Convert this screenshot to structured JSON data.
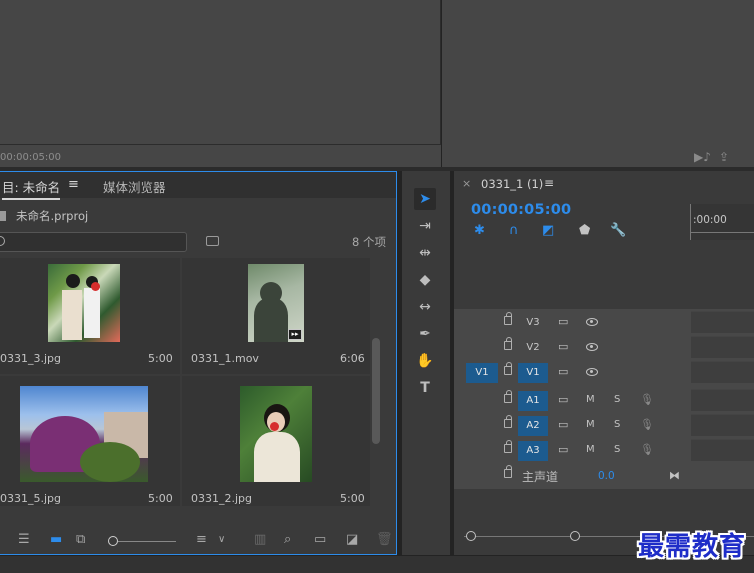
{
  "program_monitor": {
    "timecode": "00:00:05:00"
  },
  "project_panel": {
    "tab_project": "目: 未命名",
    "tab_menu": "≡",
    "tab_media_browser": "媒体浏览器",
    "project_file": "未命名.prproj",
    "item_count": "8 个项",
    "items": [
      {
        "name": "0331_3.jpg",
        "duration": "5:00"
      },
      {
        "name": "0331_1.mov",
        "duration": "6:06"
      },
      {
        "name": "0331_5.jpg",
        "duration": "5:00"
      },
      {
        "name": "0331_2.jpg",
        "duration": "5:00"
      }
    ]
  },
  "timeline": {
    "close": "×",
    "sequence_name": "0331_1 (1)",
    "menu": "≡",
    "playhead": "00:00:05:00",
    "ruler_label": ":00:00",
    "video_tracks": [
      {
        "name": "V3",
        "targeted": false
      },
      {
        "name": "V2",
        "targeted": false
      },
      {
        "name": "V1",
        "targeted": true,
        "source": "V1"
      }
    ],
    "audio_tracks": [
      {
        "name": "A1",
        "m": "M",
        "s": "S"
      },
      {
        "name": "A2",
        "m": "M",
        "s": "S"
      },
      {
        "name": "A3",
        "m": "M",
        "s": "S"
      }
    ],
    "master": {
      "label": "主声道",
      "value": "0.0"
    }
  },
  "colors": {
    "accent": "#2d8ceb",
    "track_target": "#1c5b8f",
    "panel": "#3a3a3a"
  },
  "watermark": "最需教育"
}
